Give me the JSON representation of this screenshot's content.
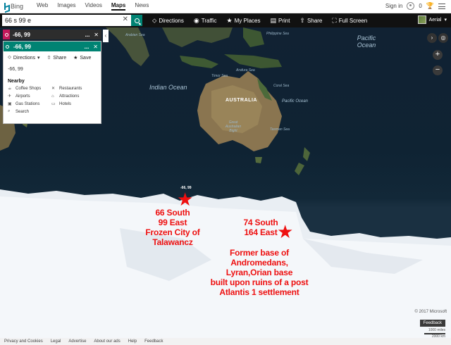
{
  "topnav": {
    "logo_text": "Bing",
    "links": [
      "Web",
      "Images",
      "Videos",
      "Maps",
      "News"
    ],
    "active": "Maps",
    "signin": "Sign in",
    "reward_count": "0"
  },
  "toolbar": {
    "search_value": "66 s 99 e",
    "clear": "✕",
    "items": [
      {
        "label": "Directions",
        "icon": "directions-icon"
      },
      {
        "label": "Traffic",
        "icon": "traffic-icon"
      },
      {
        "label": "My Places",
        "icon": "star-icon"
      },
      {
        "label": "Print",
        "icon": "print-icon"
      },
      {
        "label": "Share",
        "icon": "share-icon"
      },
      {
        "label": "Full Screen",
        "icon": "fullscreen-icon"
      }
    ],
    "view_label": "Aerial"
  },
  "left_panel": {
    "strip_title": "-66, 99",
    "card_title": "-66, 99",
    "actions": {
      "directions": "Directions",
      "share": "Share",
      "save": "Save"
    },
    "coords": "-66, 99",
    "nearby_title": "Nearby",
    "nearby": [
      {
        "label": "Coffee Shops",
        "icon": "coffee-icon"
      },
      {
        "label": "Restaurants",
        "icon": "restaurant-icon"
      },
      {
        "label": "Airports",
        "icon": "airport-icon"
      },
      {
        "label": "Attractions",
        "icon": "attractions-icon"
      },
      {
        "label": "Gas Stations",
        "icon": "gas-icon"
      },
      {
        "label": "Hotels",
        "icon": "hotel-icon"
      },
      {
        "label": "Search",
        "icon": "search-icon"
      }
    ],
    "more": "...",
    "close": "✕"
  },
  "map": {
    "labels": {
      "indian_ocean": "Indian Ocean",
      "pacific_ocean": "Pacific Ocean",
      "australia": "AUSTRALIA",
      "pacific_ocean_small": "Pacific Ocean",
      "arabian_sea": "Arabian Sea",
      "arafura_sea": "Arafura Sea",
      "coral_sea": "Coral Sea",
      "timor_sea": "Timor Sea",
      "philippine_sea": "Philippine Sea",
      "tasman_sea": "Tasman Sea",
      "great_australian_bight": "Great Australian Bight"
    },
    "pin_label": "-66, 99",
    "annotation_1": [
      "66 South",
      "99 East",
      "Frozen City of",
      "Talawancz"
    ],
    "annotation_2": [
      "74 South",
      "164 East"
    ],
    "annotation_3": [
      "Former base of",
      "Andromedans,",
      "Lyran,Orian base",
      "built upon ruins of a post",
      "Atlantis 1 settlement"
    ],
    "colors": {
      "annotation": "#ee1010",
      "ocean": "#112233",
      "ice": "#eef2f6",
      "toolbar": "#111111",
      "accent": "#008373"
    }
  },
  "bottom": {
    "copyright": "© 2017 Microsoft",
    "feedback": "Feedback",
    "scale_top": "1000 miles",
    "scale_bottom": "2000 km",
    "footer_links": [
      "Privacy and Cookies",
      "Legal",
      "Advertise",
      "About our ads",
      "Help",
      "Feedback"
    ]
  }
}
